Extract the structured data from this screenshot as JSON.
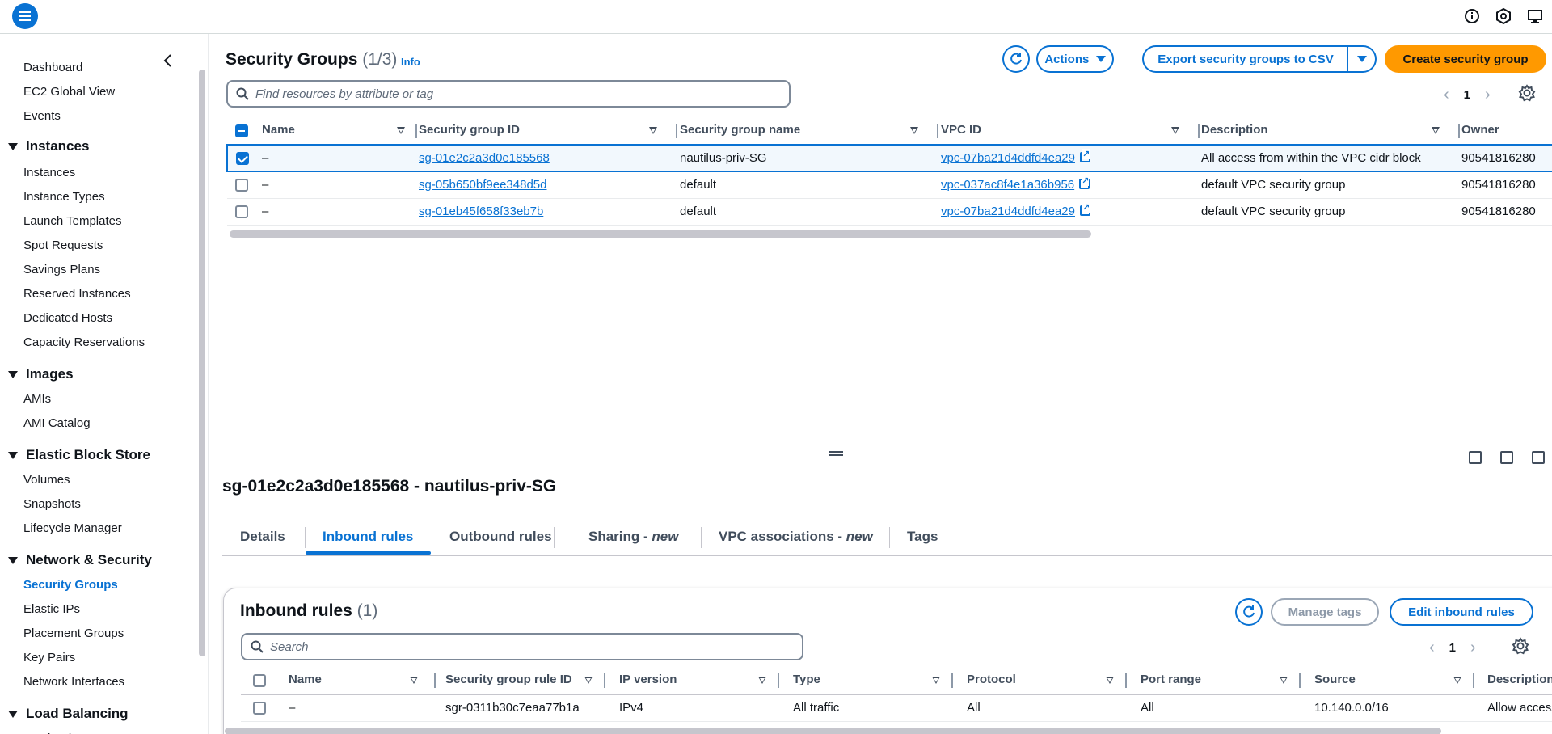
{
  "top_icons": [
    "info-icon",
    "hexagon-settings-icon",
    "display-feedback-icon"
  ],
  "sidebar": {
    "items": [
      {
        "type": "link",
        "label": "Dashboard"
      },
      {
        "type": "link",
        "label": "EC2 Global View"
      },
      {
        "type": "link",
        "label": "Events"
      },
      {
        "type": "head",
        "label": "Instances"
      },
      {
        "type": "link",
        "label": "Instances"
      },
      {
        "type": "link",
        "label": "Instance Types"
      },
      {
        "type": "link",
        "label": "Launch Templates"
      },
      {
        "type": "link",
        "label": "Spot Requests"
      },
      {
        "type": "link",
        "label": "Savings Plans"
      },
      {
        "type": "link",
        "label": "Reserved Instances"
      },
      {
        "type": "link",
        "label": "Dedicated Hosts"
      },
      {
        "type": "link",
        "label": "Capacity Reservations"
      },
      {
        "type": "head",
        "label": "Images"
      },
      {
        "type": "link",
        "label": "AMIs"
      },
      {
        "type": "link",
        "label": "AMI Catalog"
      },
      {
        "type": "head",
        "label": "Elastic Block Store"
      },
      {
        "type": "link",
        "label": "Volumes"
      },
      {
        "type": "link",
        "label": "Snapshots"
      },
      {
        "type": "link",
        "label": "Lifecycle Manager"
      },
      {
        "type": "head",
        "label": "Network & Security"
      },
      {
        "type": "link",
        "label": "Security Groups",
        "active": true
      },
      {
        "type": "link",
        "label": "Elastic IPs"
      },
      {
        "type": "link",
        "label": "Placement Groups"
      },
      {
        "type": "link",
        "label": "Key Pairs"
      },
      {
        "type": "link",
        "label": "Network Interfaces"
      },
      {
        "type": "head",
        "label": "Load Balancing"
      },
      {
        "type": "link",
        "label": "Load Balancers"
      }
    ]
  },
  "sg_panel": {
    "title": "Security Groups",
    "count": "(1/3)",
    "info": "Info",
    "actions_label": "Actions",
    "export_label": "Export security groups to CSV",
    "create_label": "Create security group",
    "search_placeholder": "Find resources by attribute or tag",
    "page": "1",
    "columns": [
      "Name",
      "Security group ID",
      "Security group name",
      "VPC ID",
      "Description",
      "Owner"
    ],
    "rows": [
      {
        "selected": true,
        "name": "–",
        "id": "sg-01e2c2a3d0e185568",
        "group_name": "nautilus-priv-SG",
        "vpc": "vpc-07ba21d4ddfd4ea29",
        "description": "All access from within the VPC cidr block",
        "owner": "90541816280"
      },
      {
        "selected": false,
        "name": "–",
        "id": "sg-05b650bf9ee348d5d",
        "group_name": "default",
        "vpc": "vpc-037ac8f4e1a36b956",
        "description": "default VPC security group",
        "owner": "90541816280"
      },
      {
        "selected": false,
        "name": "–",
        "id": "sg-01eb45f658f33eb7b",
        "group_name": "default",
        "vpc": "vpc-07ba21d4ddfd4ea29",
        "description": "default VPC security group",
        "owner": "90541816280"
      }
    ]
  },
  "detail": {
    "title": "sg-01e2c2a3d0e185568 - nautilus-priv-SG",
    "tabs": [
      {
        "label": "Details",
        "suffix": ""
      },
      {
        "label": "Inbound rules",
        "suffix": ""
      },
      {
        "label": "Outbound rules",
        "suffix": ""
      },
      {
        "label": "Sharing - ",
        "suffix": "new"
      },
      {
        "label": "VPC associations - ",
        "suffix": "new"
      },
      {
        "label": "Tags",
        "suffix": ""
      }
    ],
    "active_tab": "Inbound rules"
  },
  "inbound": {
    "title": "Inbound rules",
    "count": "(1)",
    "manage_tags_label": "Manage tags",
    "edit_label": "Edit inbound rules",
    "search_placeholder": "Search",
    "page": "1",
    "columns": [
      "Name",
      "Security group rule ID",
      "IP version",
      "Type",
      "Protocol",
      "Port range",
      "Source",
      "Description"
    ],
    "rows": [
      {
        "name": "–",
        "rule_id": "sgr-0311b30c7eaa77b1a",
        "ip_version": "IPv4",
        "type": "All traffic",
        "protocol": "All",
        "port_range": "All",
        "source": "10.140.0.0/16",
        "description": "Allow access"
      }
    ]
  },
  "colors": {
    "accent": "#0972d3",
    "primary_button": "#ff9900",
    "selected_row_bg": "#f2f8fd"
  }
}
